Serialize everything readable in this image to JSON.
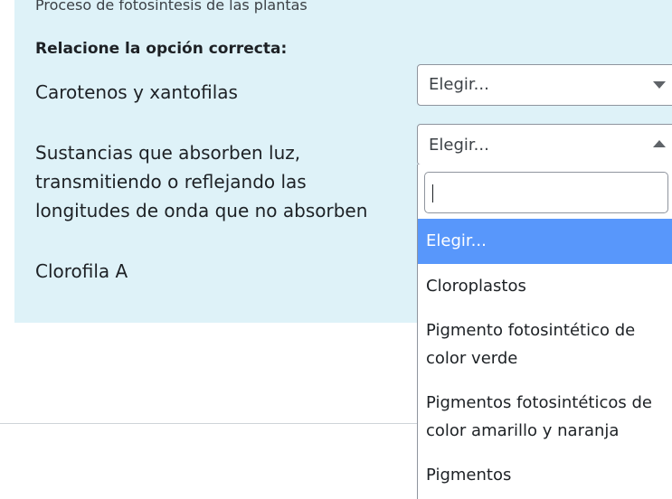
{
  "quiz": {
    "intro_text": "Proceso de fotosíntesis de las plantas",
    "instruction": "Relacione la opción correcta:",
    "stems": [
      {
        "text": "Carotenos y xantofilas"
      },
      {
        "text": "Sustancias que absorben luz, transmitiendo o  reflejando las longitudes de onda que no absorben"
      },
      {
        "text": "Clorofila A"
      }
    ],
    "selects": [
      {
        "value": "Elegir..."
      },
      {
        "value": "Elegir..."
      }
    ]
  },
  "dropdown": {
    "search_value": "",
    "options": [
      {
        "label": "Elegir..."
      },
      {
        "label": "Cloroplastos"
      },
      {
        "label": "Pigmento fotosintético de color verde"
      },
      {
        "label": "Pigmentos fotosintéticos de color amarillo y naranja"
      },
      {
        "label": "Pigmentos"
      }
    ],
    "highlighted_index": 0
  },
  "colors": {
    "panel_bg": "#def2f8",
    "highlight": "#5897fb"
  },
  "icons": [
    "chevron-down-icon",
    "chevron-up-icon"
  ]
}
